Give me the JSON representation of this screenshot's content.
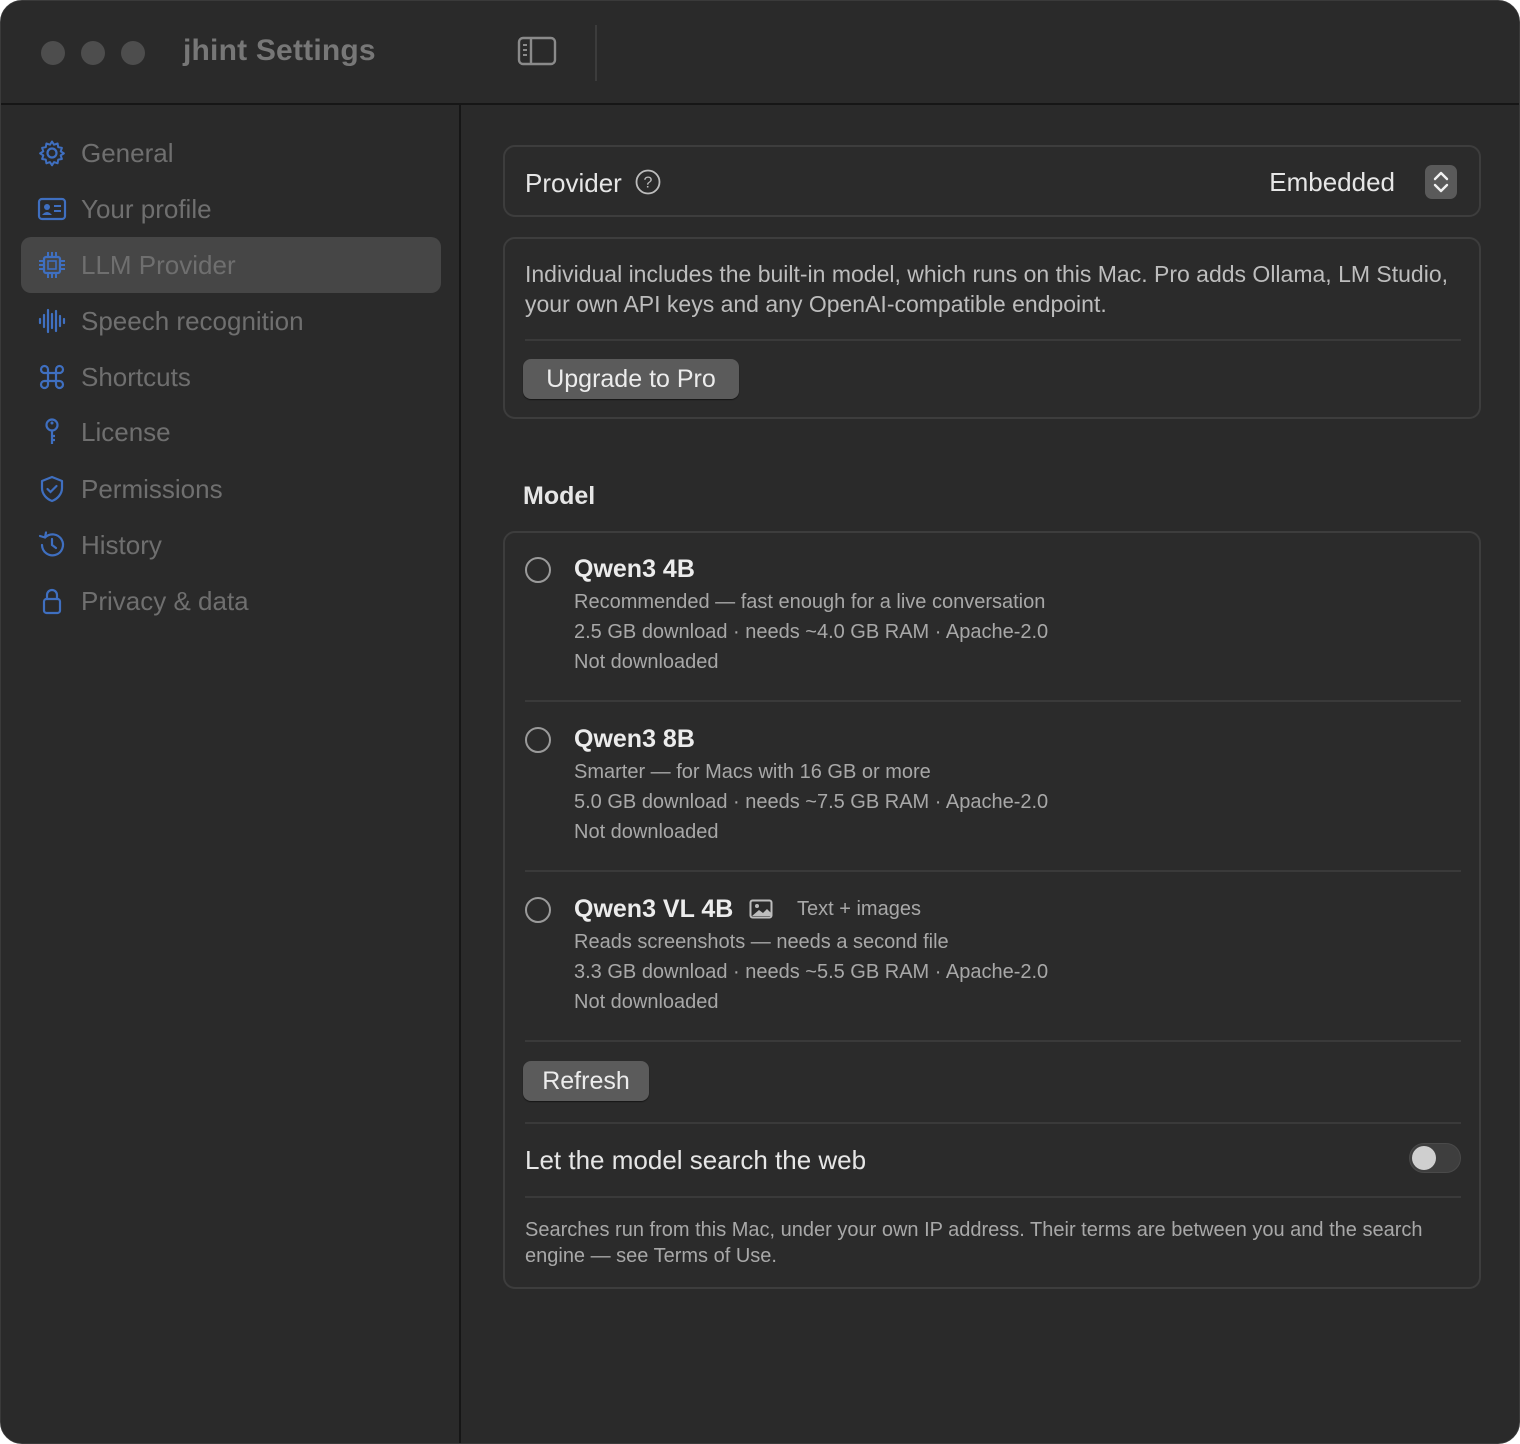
{
  "window": {
    "title": "jhint Settings"
  },
  "sidebar": {
    "items": [
      {
        "label": "General",
        "icon": "gear-icon"
      },
      {
        "label": "Your profile",
        "icon": "id-card-icon"
      },
      {
        "label": "LLM Provider",
        "icon": "cpu-chip-icon",
        "selected": true
      },
      {
        "label": "Speech recognition",
        "icon": "waveform-icon"
      },
      {
        "label": "Shortcuts",
        "icon": "command-icon"
      },
      {
        "label": "License",
        "icon": "key-icon"
      },
      {
        "label": "Permissions",
        "icon": "shield-check-icon"
      },
      {
        "label": "History",
        "icon": "clock-history-icon"
      },
      {
        "label": "Privacy & data",
        "icon": "lock-icon"
      }
    ]
  },
  "provider": {
    "label": "Provider",
    "value": "Embedded"
  },
  "upgrade": {
    "description": "Individual includes the built-in model, which runs on this Mac. Pro adds Ollama, LM Studio, your own API keys and any OpenAI-compatible endpoint.",
    "button_label": "Upgrade to Pro"
  },
  "model": {
    "section_title": "Model",
    "items": [
      {
        "name": "Qwen3 4B",
        "tagline": "Recommended — fast enough for a live conversation",
        "specs": "2.5 GB download · needs ~4.0 GB RAM · Apache-2.0",
        "status": "Not downloaded",
        "selected": false
      },
      {
        "name": "Qwen3 8B",
        "tagline": "Smarter — for Macs with 16 GB or more",
        "specs": "5.0 GB download · needs ~7.5 GB RAM · Apache-2.0",
        "status": "Not downloaded",
        "selected": false
      },
      {
        "name": "Qwen3 VL 4B",
        "tag": "Text + images",
        "tagline": "Reads screenshots — needs a second file",
        "specs": "3.3 GB download · needs ~5.5 GB RAM · Apache-2.0",
        "status": "Not downloaded",
        "selected": false
      }
    ],
    "refresh_label": "Refresh",
    "web_search": {
      "label": "Let the model search the web",
      "enabled": false
    },
    "footnote": "Searches run from this Mac, under your own IP address. Their terms are between you and the search engine — see Terms of Use."
  },
  "colors": {
    "window_bg": "#2a2a2a",
    "selection": "#464646",
    "sidebar_icon": "#3f6fc0",
    "text_primary": "#e6e6e6",
    "text_secondary": "#a8a8a8"
  }
}
